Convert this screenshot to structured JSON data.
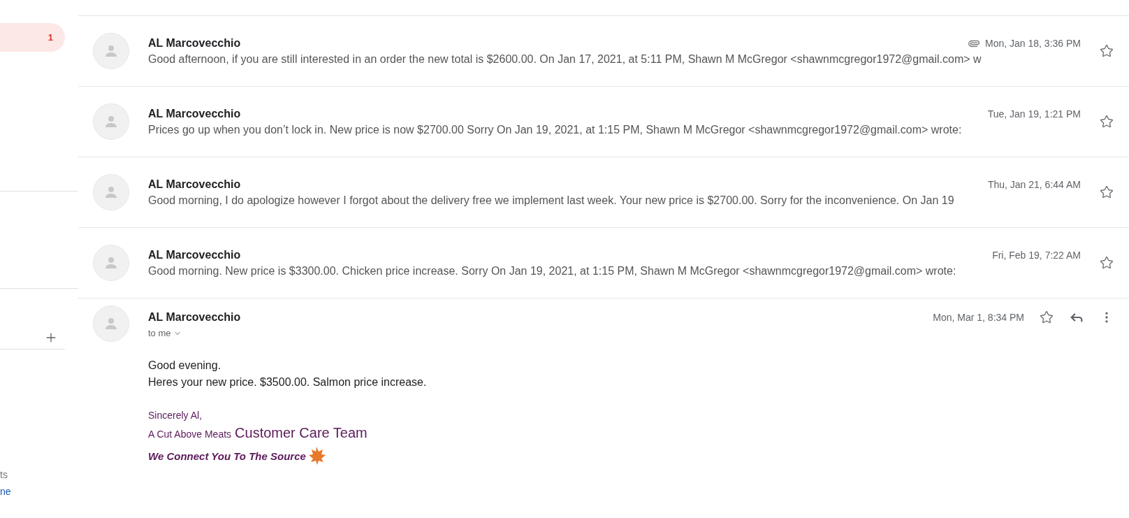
{
  "sidebar": {
    "items": [
      {
        "count": "1",
        "selected": true
      }
    ],
    "footer_texts": [
      {
        "text": "ts",
        "kind": "plain"
      },
      {
        "text": "ne",
        "kind": "link"
      }
    ]
  },
  "messages": [
    {
      "sender": "AL Marcovecchio",
      "snippet": "Good afternoon, if you are still interested in an order the new total is $2600.00. On Jan 17, 2021, at 5:11 PM, Shawn M McGregor <shawnmcgregor1972@gmail.com> w",
      "date": "Mon, Jan 18, 3:36 PM",
      "attachment": true,
      "starred": false
    },
    {
      "sender": "AL Marcovecchio",
      "snippet": "Prices go up when you don’t lock in. New price is now $2700.00 Sorry On Jan 19, 2021, at 1:15 PM, Shawn M McGregor <shawnmcgregor1972@gmail.com> wrote:",
      "date": "Tue, Jan 19, 1:21 PM",
      "attachment": false,
      "starred": false
    },
    {
      "sender": "AL Marcovecchio",
      "snippet": "Good morning, I do apologize however I forgot about the delivery free we implement last week. Your new price is $2700.00. Sorry for the inconvenience. On Jan 19",
      "date": "Thu, Jan 21, 6:44 AM",
      "attachment": false,
      "starred": false
    },
    {
      "sender": "AL Marcovecchio",
      "snippet": "Good morning. New price is $3300.00. Chicken price increase. Sorry On Jan 19, 2021, at 1:15 PM, Shawn M McGregor <shawnmcgregor1972@gmail.com> wrote:",
      "date": "Fri, Feb 19, 7:22 AM",
      "attachment": false,
      "starred": false
    }
  ],
  "open_message": {
    "sender": "AL Marcovecchio",
    "recipient": "to me",
    "date": "Mon, Mar 1, 8:34 PM",
    "starred": false,
    "body": [
      "Good evening.",
      "Heres your new price. $3500.00. Salmon price increase."
    ],
    "signature": {
      "closing": "Sincerely Al,",
      "company": "A Cut Above Meats",
      "team": "Customer Care Team",
      "tagline": "We Connect You To The Source"
    }
  }
}
